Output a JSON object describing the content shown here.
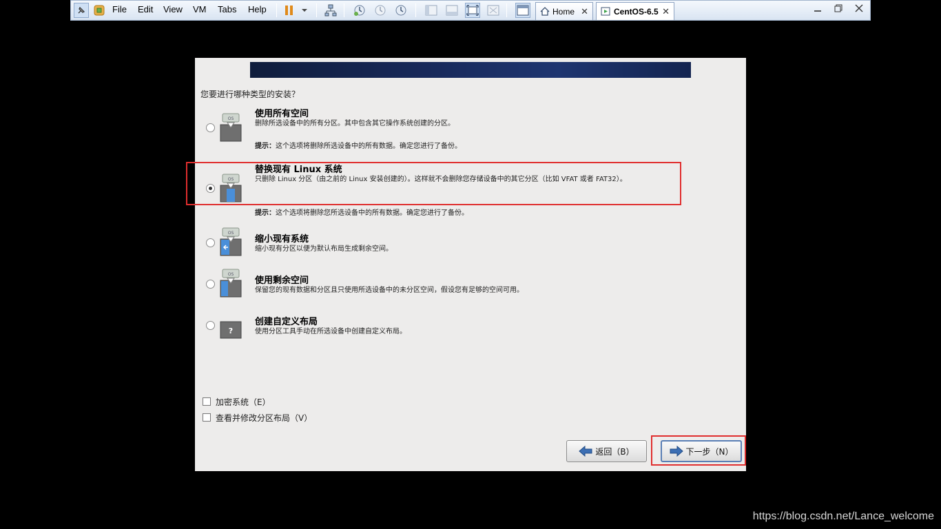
{
  "toolbar": {
    "menus": [
      "File",
      "Edit",
      "View",
      "VM",
      "Tabs",
      "Help"
    ],
    "tabs": [
      {
        "label": "Home",
        "close": "✕"
      },
      {
        "label": "CentOS-6.5",
        "close": "✕"
      }
    ],
    "accent": "#1e3570"
  },
  "installer": {
    "question": "您要进行哪种类型的安装？",
    "options": [
      {
        "title": "使用所有空间",
        "desc": "删除所选设备中的所有分区。其中包含其它操作系统创建的分区。",
        "hint_label": "提示：",
        "hint": "这个选项将删除所选设备中的所有数据。确定您进行了备份。",
        "selected": false,
        "icon": "disk-os-erase-icon"
      },
      {
        "title": "替换现有 Linux 系统",
        "desc": "只删除 Linux 分区（由之前的 Linux 安装创建的）。这样就不会删除您存储设备中的其它分区（比如 VFAT 或者 FAT32）。",
        "hint_label": "提示：",
        "hint": "这个选项将删除您所选设备中的所有数据。确定您进行了备份。",
        "selected": true,
        "icon": "disk-os-replace-icon"
      },
      {
        "title": "缩小现有系统",
        "desc": "缩小现有分区以便为默认布局生成剩余空间。",
        "selected": false,
        "icon": "disk-os-shrink-icon"
      },
      {
        "title": "使用剩余空间",
        "desc": "保留您的现有数据和分区且只使用所选设备中的未分区空间，假设您有足够的空间可用。",
        "selected": false,
        "icon": "disk-os-free-icon"
      },
      {
        "title": "创建自定义布局",
        "desc": "使用分区工具手动在所选设备中创建自定义布局。",
        "selected": false,
        "icon": "disk-custom-icon"
      }
    ],
    "checkboxes": [
      {
        "label": "加密系统（E）",
        "checked": false
      },
      {
        "label": "查看并修改分区布局（V）",
        "checked": false
      }
    ],
    "back_label": "返回（B）",
    "next_label": "下一步（N）"
  },
  "watermark": "https://blog.csdn.net/Lance_welcome"
}
